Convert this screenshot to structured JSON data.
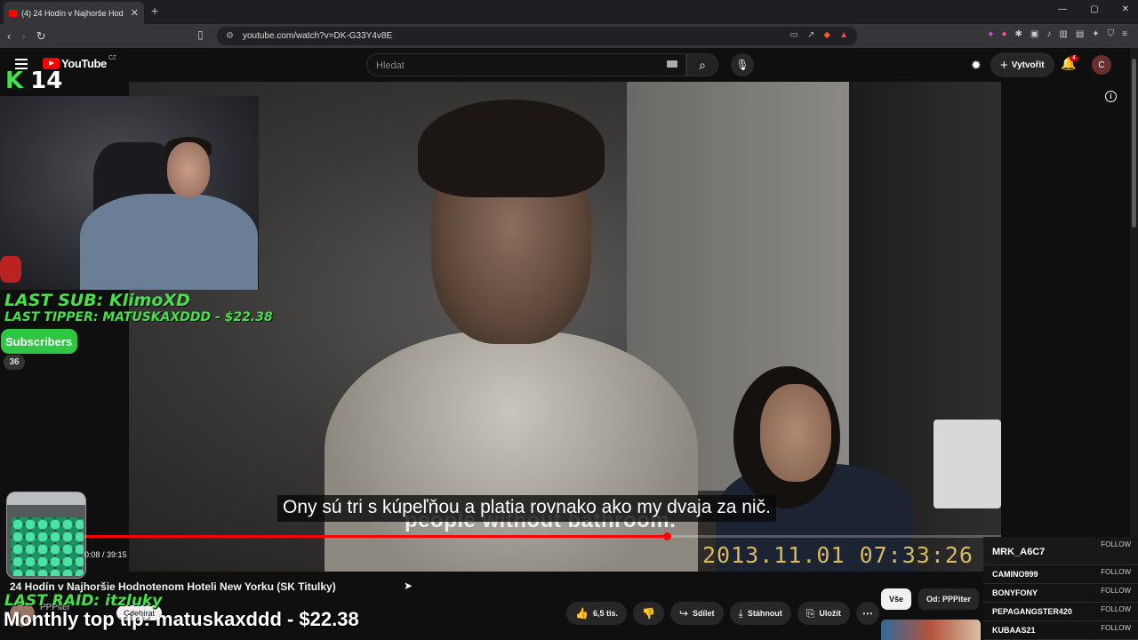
{
  "browser": {
    "tab_title": "(4) 24 Hodín v Najhorše Hod",
    "new_tab": "+",
    "url": "youtube.com/watch?v=DK-G33Y4v8E",
    "window_controls": [
      "—",
      "▢",
      "✕"
    ]
  },
  "youtube": {
    "logo_text": "YouTube",
    "logo_region": "CZ",
    "search_placeholder": "Hledat",
    "create_label": "Vytvořit",
    "notifications_count": "4",
    "avatar_letter": "C"
  },
  "video": {
    "caption": "Ony sú tri s kúpeľňou a platia rovnako ako my dvaja za nič.",
    "burned_subtitle": "people without bathroom.",
    "datestamp": "2013.11.01  07:33:26",
    "timecode": "0:08 / 39:15",
    "progress_fraction": 0.635
  },
  "overlay": {
    "k14_letter": "K",
    "k14_number": "14",
    "last_sub": "LAST SUB: KlimoXD",
    "last_tipper": "LAST TIPPER: MATUSKAXDDD - $22.38",
    "subscribers_label": "Subscribers",
    "subscribers_count": "36",
    "last_raid": "LAST RAID: itzluky",
    "monthly_top_tip": "Monthly top tip: matuskaxddd - $22.38",
    "follows": [
      {
        "user": "MRK_A6C7",
        "action": "FOLLOW"
      },
      {
        "user": "CAMINO999",
        "action": "FOLLOW"
      },
      {
        "user": "BONYFONY",
        "action": "FOLLOW"
      },
      {
        "user": "PEPAGANGSTER420",
        "action": "FOLLOW"
      },
      {
        "user": "KUBAAS21",
        "action": "FOLLOW"
      }
    ]
  },
  "info": {
    "title": "24 Hodín v Najhoršie Hodnotenom Hoteli New Yorku (SK Titulky)",
    "channel": "PPPiter",
    "subscribe_label": "Odebírat",
    "like_count": "6,5 tis.",
    "share_label": "Sdílet",
    "download_label": "Stáhnout",
    "save_label": "Uložit"
  },
  "filters": {
    "chips": [
      "Vše",
      "Od: PPPiter"
    ]
  },
  "colors": {
    "accent_red": "#ff0000",
    "overlay_green": "#45e04a",
    "background": "#0f0f0f"
  }
}
